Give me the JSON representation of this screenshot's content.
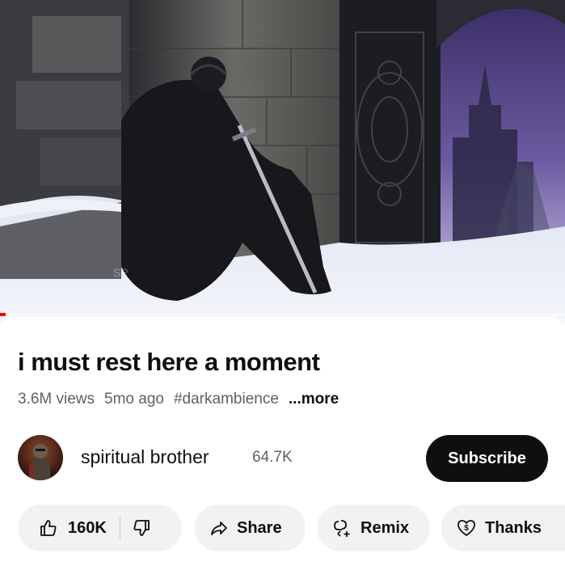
{
  "video": {
    "title": "i must rest here a moment",
    "views": "3.6M views",
    "age": "5mo ago",
    "hashtag": "#darkambience",
    "more_label": "...more",
    "watermark": "SP",
    "progress_fraction": 0.01
  },
  "channel": {
    "name": "spiritual brother",
    "subscribers": "64.7K",
    "subscribe_label": "Subscribe"
  },
  "actions": {
    "like_count": "160K",
    "share_label": "Share",
    "remix_label": "Remix",
    "thanks_label": "Thanks"
  },
  "icons": [
    "thumb-up-icon",
    "thumb-down-icon",
    "share-arrow-icon",
    "remix-icon",
    "thanks-heart-icon"
  ],
  "colors": {
    "subscribe_bg": "#0f0f0f",
    "pill_bg": "#f2f2f2",
    "progress": "#ff0000",
    "meta_text": "#606060"
  }
}
